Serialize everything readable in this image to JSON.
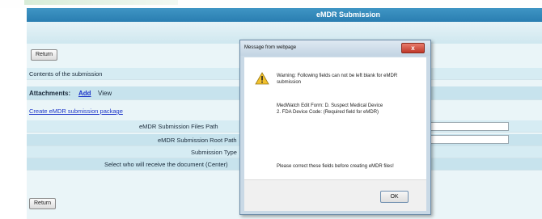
{
  "header": {
    "title": "eMDR Submission"
  },
  "buttons": {
    "return_top": "Return",
    "return_bottom": "Return"
  },
  "contents": {
    "label": "Contents of the submission"
  },
  "attachments": {
    "label": "Attachments:",
    "add": "Add",
    "view": "View"
  },
  "create_link": "Create eMDR submission package",
  "form_rows": [
    {
      "label": "eMDR Submission Files Path"
    },
    {
      "label": "eMDR Submission Root Path"
    },
    {
      "label": "Submission Type"
    },
    {
      "label": "Select who will receive the document (Center)"
    }
  ],
  "dialog": {
    "title": "Message from webpage",
    "close": "x",
    "warning_line1": "Warning: Following fields can not be left blank for eMDR",
    "warning_line2": "submission",
    "detail_line1": "MedWatch Edit Form: D. Suspect Medical Device",
    "detail_line2": "2. FDA Device Code: (Required field for eMDR)",
    "instruction": "Please correct these fields before creating eMDR files!",
    "ok": "OK"
  },
  "colors": {
    "banner": "#2a7eb1",
    "panel": "#eaf5f8",
    "link": "#1c35c9"
  }
}
